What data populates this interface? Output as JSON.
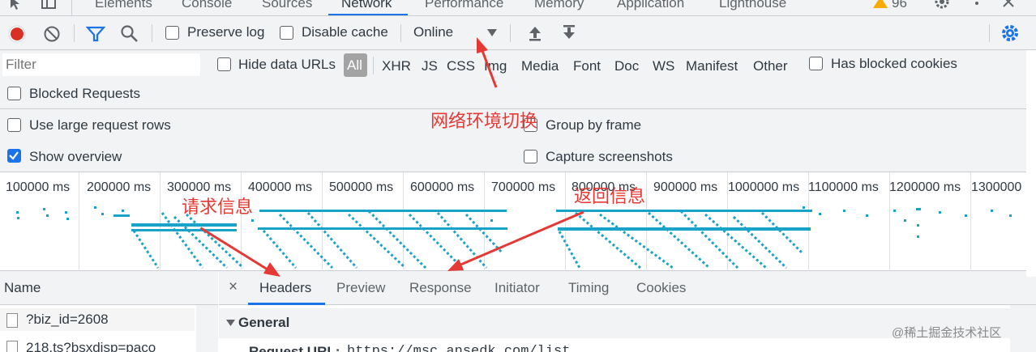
{
  "devtools_tabs": [
    "Elements",
    "Console",
    "Sources",
    "Network",
    "Performance",
    "Memory",
    "Application",
    "Lighthouse"
  ],
  "warning_count": "96",
  "toolbar": {
    "preserve_log": "Preserve log",
    "disable_cache": "Disable cache",
    "throttle_value": "Online"
  },
  "filter": {
    "placeholder": "Filter",
    "hide_data_urls": "Hide data URLs",
    "types": [
      "All",
      "XHR",
      "JS",
      "CSS",
      "Img",
      "Media",
      "Font",
      "Doc",
      "WS",
      "Manifest",
      "Other"
    ],
    "has_blocked_cookies": "Has blocked cookies",
    "blocked_requests": "Blocked Requests"
  },
  "settings": {
    "large_rows": "Use large request rows",
    "group_by_frame": "Group by frame",
    "show_overview": "Show overview",
    "capture_screenshots": "Capture screenshots"
  },
  "timeline_ticks": [
    "100000 ms",
    "200000 ms",
    "300000 ms",
    "400000 ms",
    "500000 ms",
    "600000 ms",
    "700000 ms",
    "800000 ms",
    "900000 ms",
    "1000000 ms",
    "1100000 ms",
    "1200000 ms",
    "1300000"
  ],
  "request_list": {
    "header": "Name",
    "rows": [
      "?biz_id=2608",
      "218.ts?bsxdisp=paco"
    ]
  },
  "detail_tabs": [
    "Headers",
    "Preview",
    "Response",
    "Initiator",
    "Timing",
    "Cookies"
  ],
  "close_glyph": "×",
  "general": {
    "title": "General",
    "request_url_label": "Request URL:",
    "request_url_value": "https://msc.ansedk.com/list"
  },
  "annotations": {
    "network_switch": "网络环境切换",
    "request_info": "请求信息",
    "response_info": "返回信息"
  },
  "watermark": "@稀土掘金技术社区",
  "colors": {
    "accent": "#1a73e8",
    "record": "#d93025",
    "annotation": "#e53935",
    "waterfall": "#1aa3c8"
  }
}
